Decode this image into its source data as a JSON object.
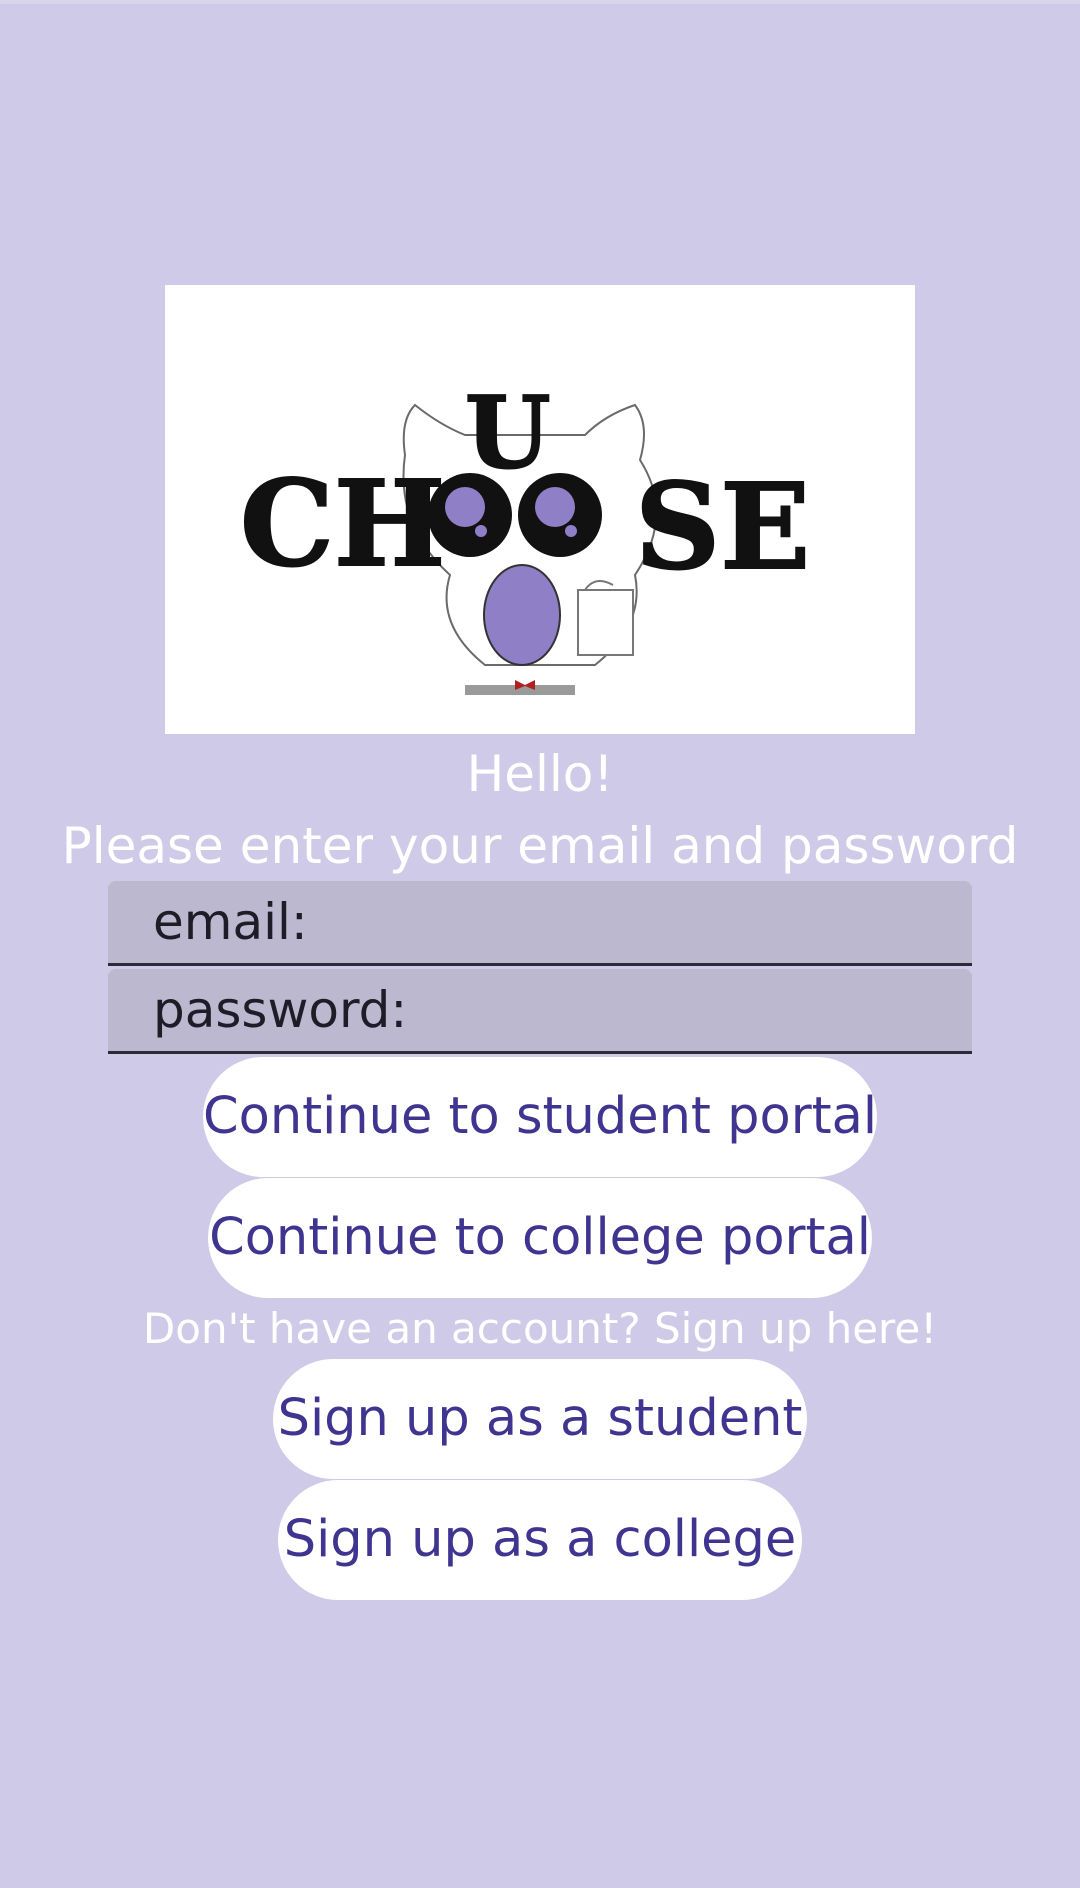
{
  "logo": {
    "letters_left": "CH",
    "letters_right": "SE",
    "letter_top": "U"
  },
  "login": {
    "greeting": "Hello!",
    "instruction": "Please enter your email and password",
    "email_placeholder": "email:",
    "password_placeholder": "password:",
    "student_portal_label": "Continue to student portal",
    "college_portal_label": "Continue to college portal"
  },
  "signup": {
    "prompt": "Don't have an account? Sign up here!",
    "student_label": "Sign up as a student",
    "college_label": "Sign up as a college"
  },
  "colors": {
    "background": "#cfcae7",
    "button_text": "#3f3590",
    "field_background": "#bcb8cf",
    "owl_accent": "#8f7fc7"
  }
}
